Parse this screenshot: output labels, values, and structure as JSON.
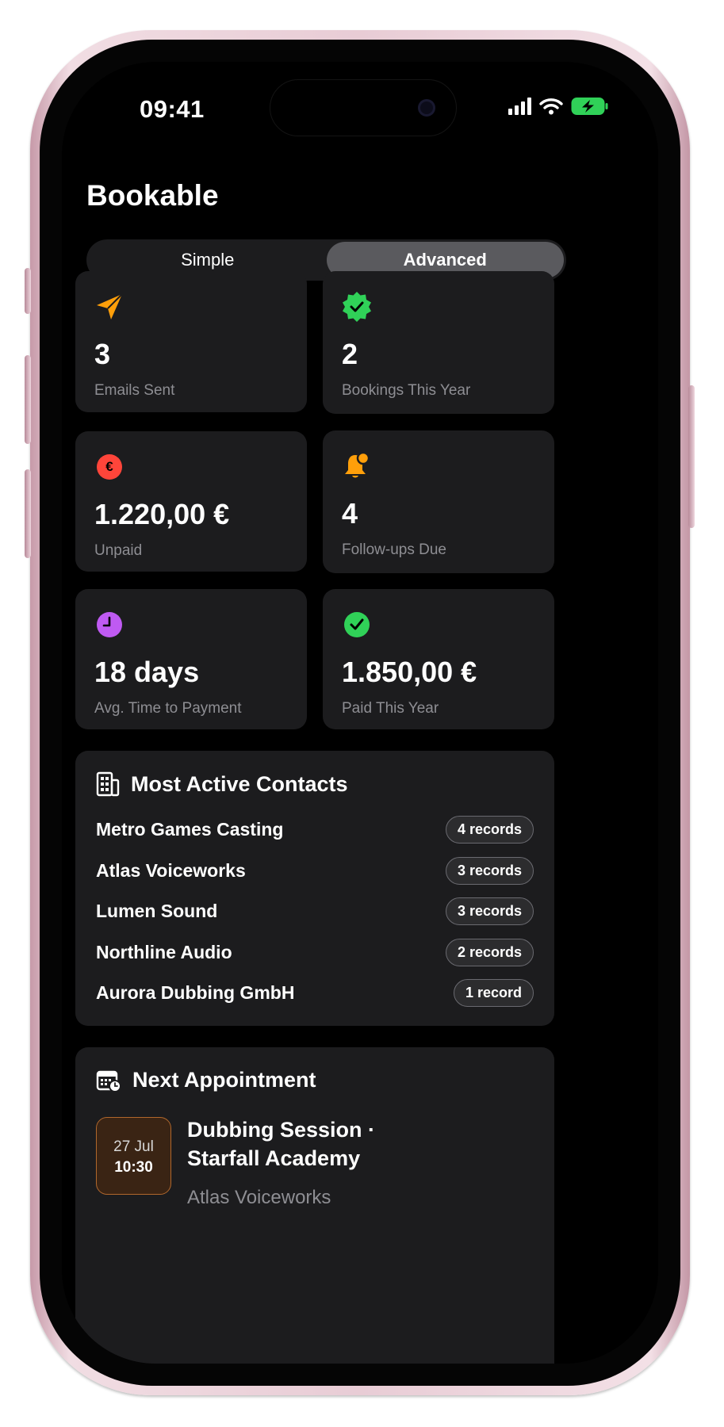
{
  "status_bar": {
    "time": "09:41"
  },
  "header": {
    "title": "Bookable"
  },
  "mode_switch": {
    "options": [
      "Simple",
      "Advanced"
    ],
    "selected": "Advanced"
  },
  "stats": [
    {
      "icon": "paper-plane-icon",
      "color": "#ff9f0a",
      "value": "3",
      "label": "Emails Sent"
    },
    {
      "icon": "verified-badge-icon",
      "color": "#30d158",
      "value": "2",
      "label": "Bookings This Year"
    },
    {
      "icon": "euro-icon",
      "color": "#ff453a",
      "symbol": "€",
      "value": "1.220,00 €",
      "label": "Unpaid"
    },
    {
      "icon": "bell-badge-icon",
      "color": "#ff9f0a",
      "value": "4",
      "label": "Follow-ups Due"
    },
    {
      "icon": "clock-icon",
      "color": "#bf5af2",
      "value": "18 days",
      "label": "Avg. Time to Payment"
    },
    {
      "icon": "checkmark-circle-icon",
      "color": "#30d158",
      "value": "1.850,00 €",
      "label": "Paid This Year"
    }
  ],
  "contacts": {
    "title": "Most Active Contacts",
    "icon": "building-icon",
    "items": [
      {
        "name": "Metro Games Casting",
        "count": "4 records"
      },
      {
        "name": "Atlas Voiceworks",
        "count": "3 records"
      },
      {
        "name": "Lumen Sound",
        "count": "3 records"
      },
      {
        "name": "Northline Audio",
        "count": "2 records"
      },
      {
        "name": "Aurora Dubbing GmbH",
        "count": "1 record"
      }
    ]
  },
  "next_appointment": {
    "title": "Next Appointment",
    "icon": "calendar-clock-icon",
    "date": "27 Jul",
    "time": "10:30",
    "event_title": "Dubbing Session · Starfall Academy",
    "contact": "Atlas Voiceworks",
    "accent": "#b0672c"
  }
}
